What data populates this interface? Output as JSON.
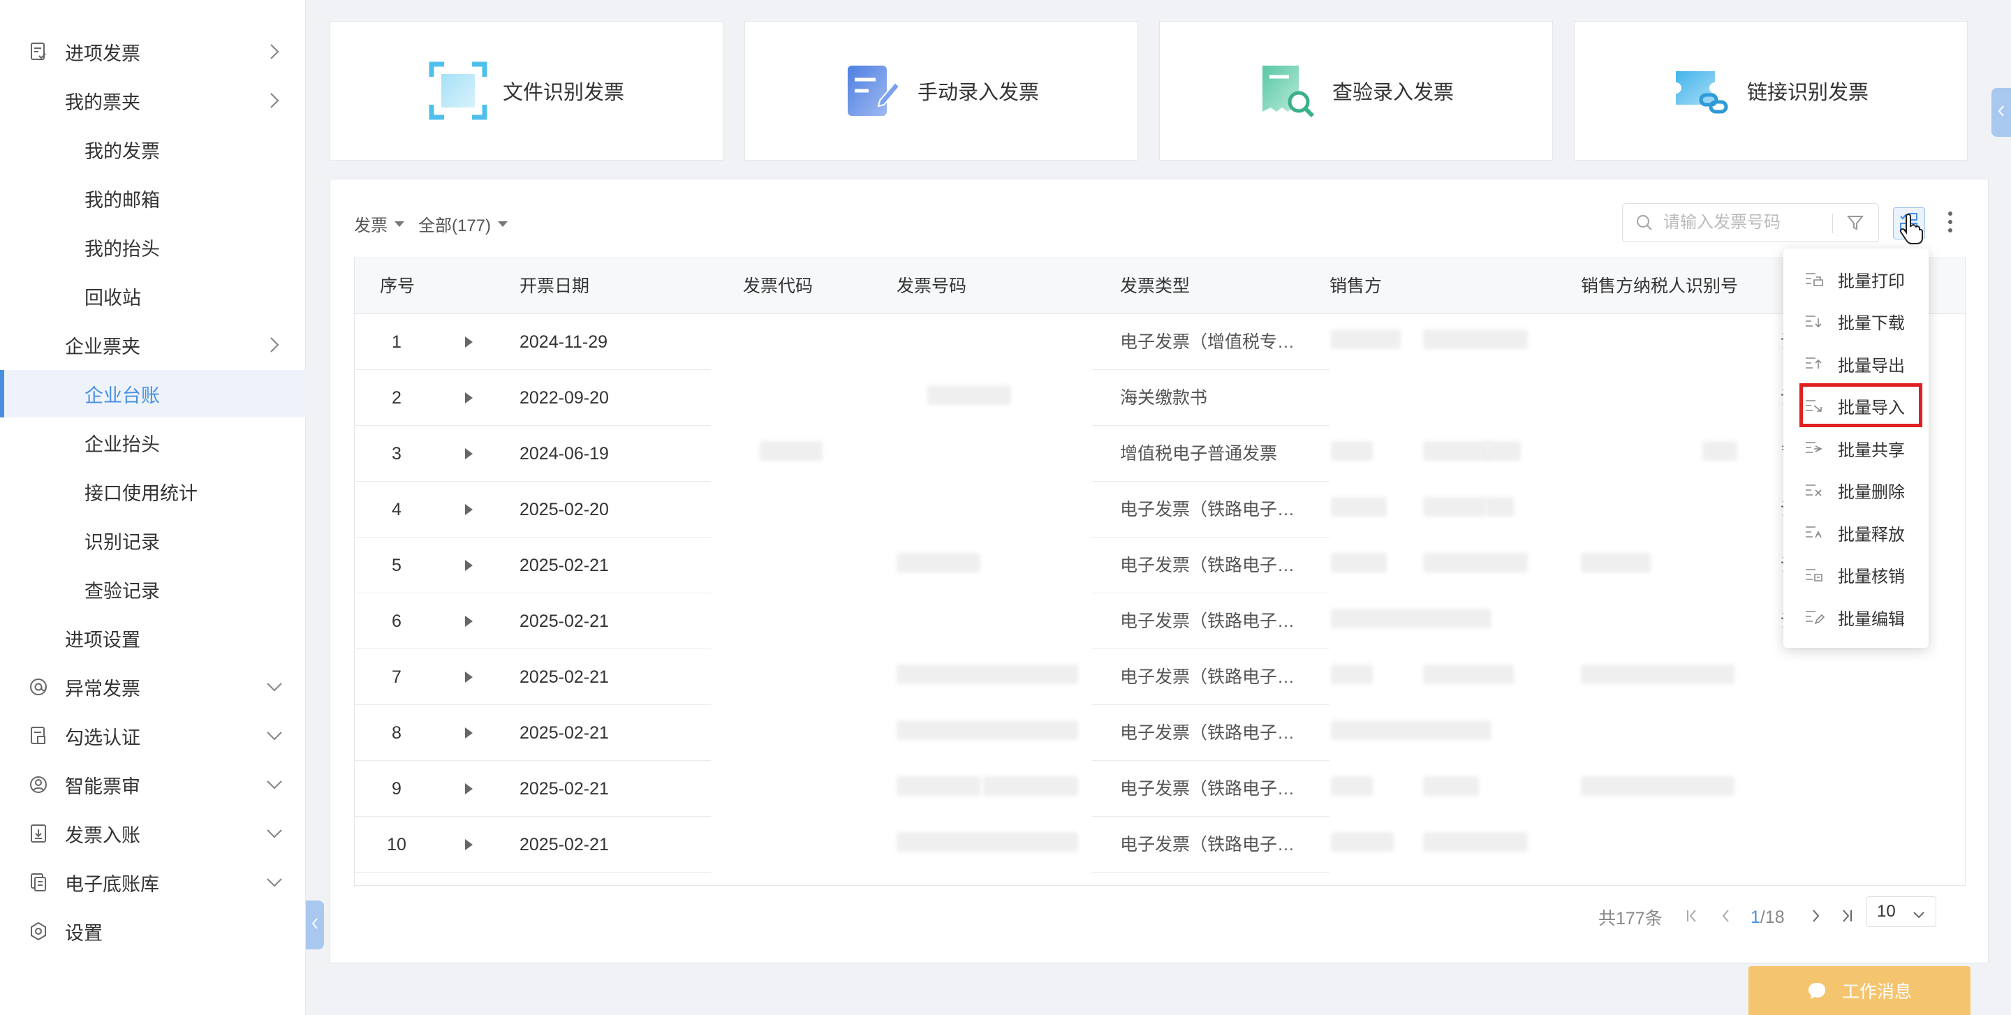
{
  "sidebar": {
    "items": [
      {
        "label": "进项发票",
        "level": 0,
        "icon": "invoice-doc-icon",
        "arrow": "right"
      },
      {
        "label": "我的票夹",
        "level": 1,
        "arrow": "right"
      },
      {
        "label": "我的发票",
        "level": 2
      },
      {
        "label": "我的邮箱",
        "level": 2
      },
      {
        "label": "我的抬头",
        "level": 2
      },
      {
        "label": "回收站",
        "level": 2
      },
      {
        "label": "企业票夹",
        "level": 1,
        "arrow": "right"
      },
      {
        "label": "企业台账",
        "level": 2,
        "active": true
      },
      {
        "label": "企业抬头",
        "level": 2
      },
      {
        "label": "接口使用统计",
        "level": 2
      },
      {
        "label": "识别记录",
        "level": 2
      },
      {
        "label": "查验记录",
        "level": 2
      },
      {
        "label": "进项设置",
        "level": 1
      },
      {
        "label": "异常发票",
        "level": 0,
        "icon": "at-icon",
        "arrow": "down"
      },
      {
        "label": "勾选认证",
        "level": 0,
        "icon": "check-doc-icon",
        "arrow": "down"
      },
      {
        "label": "智能票审",
        "level": 0,
        "icon": "user-circle-icon",
        "arrow": "down"
      },
      {
        "label": "发票入账",
        "level": 0,
        "icon": "download-doc-icon",
        "arrow": "down"
      },
      {
        "label": "电子底账库",
        "level": 0,
        "icon": "files-icon",
        "arrow": "down"
      },
      {
        "label": "设置",
        "level": 0,
        "icon": "hex-gear-icon"
      }
    ]
  },
  "cards": [
    {
      "label": "文件识别发票",
      "icon": "scan-frame-icon"
    },
    {
      "label": "手动录入发票",
      "icon": "edit-doc-icon"
    },
    {
      "label": "查验录入发票",
      "icon": "search-doc-icon"
    },
    {
      "label": "链接识别发票",
      "icon": "link-ticket-icon"
    }
  ],
  "filters": {
    "type": "发票",
    "scope": "全部(177)"
  },
  "search": {
    "placeholder": "请输入发票号码"
  },
  "table": {
    "headers": [
      "序号",
      "开票日期",
      "发票代码",
      "发票号码",
      "发票类型",
      "销售方",
      "销售方纳税人识别号"
    ],
    "rows": [
      {
        "idx": "1",
        "date": "2024-11-29",
        "type": "电子发票（增值税专用发票）",
        "tail": "设有限"
      },
      {
        "idx": "2",
        "date": "2022-09-20",
        "type": "海关缴款书",
        "tail": "设备有"
      },
      {
        "idx": "3",
        "date": "2024-06-19",
        "type": "增值税电子普通发票",
        "tail": "司"
      },
      {
        "idx": "4",
        "date": "2025-02-20",
        "type": "电子发票（铁路电子客票）",
        "tail": "设有限"
      },
      {
        "idx": "5",
        "date": "2025-02-21",
        "type": "电子发票（铁路电子客票）",
        "tail": "设有限"
      },
      {
        "idx": "6",
        "date": "2025-02-21",
        "type": "电子发票（铁路电子客票）",
        "tail": "设有限"
      },
      {
        "idx": "7",
        "date": "2025-02-21",
        "type": "电子发票（铁路电子客票）",
        "tail": ""
      },
      {
        "idx": "8",
        "date": "2025-02-21",
        "type": "电子发票（铁路电子客票）",
        "tail": ""
      },
      {
        "idx": "9",
        "date": "2025-02-21",
        "type": "电子发票（铁路电子客票）",
        "tail": ""
      },
      {
        "idx": "10",
        "date": "2025-02-21",
        "type": "电子发票（铁路电子客票）",
        "tail": ""
      }
    ]
  },
  "pagination": {
    "total": "共177条",
    "page": "1",
    "page_total": "/18",
    "page_size": "10"
  },
  "batch_menu": {
    "items": [
      {
        "label": "批量打印"
      },
      {
        "label": "批量下载"
      },
      {
        "label": "批量导出"
      },
      {
        "label": "批量导入",
        "highlighted": true
      },
      {
        "label": "批量共享"
      },
      {
        "label": "批量删除"
      },
      {
        "label": "批量释放"
      },
      {
        "label": "批量核销"
      },
      {
        "label": "批量编辑"
      }
    ]
  },
  "work_message": {
    "label": "工作消息"
  },
  "colors": {
    "accent": "#4a90e2",
    "highlight_border": "#e02020",
    "work_msg_bg": "#f5c46f"
  }
}
